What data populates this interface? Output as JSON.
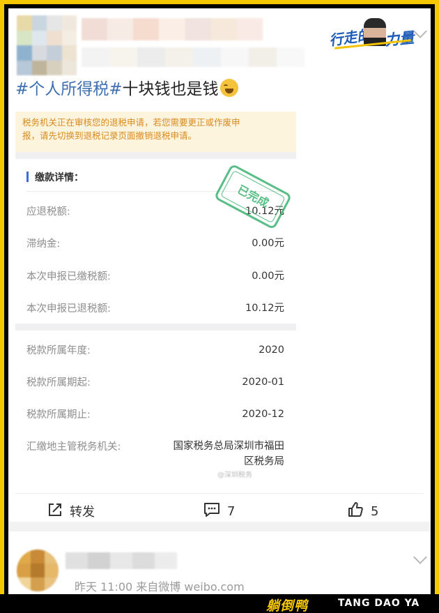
{
  "post": {
    "hashtag": "#个人所得税#",
    "text": "十块钱也是钱",
    "emoji": "laughing-crying-icon",
    "badge_part1": "行走的",
    "badge_part2": "力量"
  },
  "screenshot": {
    "notice_line1": "税务机关正在审核您的退税申请，若您需要更正或作废申",
    "notice_line2": "报，请先切换到退税记录页面撤销退税申请。",
    "section_title": "缴款详情：",
    "stamp_text": "已完成",
    "rows": [
      {
        "key": "应退税额:",
        "value": "10.12元"
      },
      {
        "key": "滞纳金:",
        "value": "0.00元"
      },
      {
        "key": "本次申报已缴税额:",
        "value": "0.00元"
      },
      {
        "key": "本次申报已退税额:",
        "value": "10.12元"
      },
      {
        "key": "税款所属年度:",
        "value": "2020"
      },
      {
        "key": "税款所属期起:",
        "value": "2020-01"
      },
      {
        "key": "税款所属期止:",
        "value": "2020-12"
      },
      {
        "key": "汇缴地主管税务机关:",
        "value_line1": "国家税务总局深圳市福田",
        "value_line2": "区税务局"
      }
    ],
    "watermark": "@深圳税务"
  },
  "actions": {
    "repost_label": "转发",
    "comment_count": "7",
    "like_count": "5"
  },
  "next_post": {
    "meta": "昨天 11:00  来自微博 weibo.com"
  },
  "brand": {
    "cn": "躺倒鸭",
    "en": "TANG DAO YA"
  },
  "colors": {
    "frame": "#f6c800",
    "hashtag": "#3f6fb0",
    "notice_text": "#d98a1e",
    "stamp": "#3cb371"
  }
}
